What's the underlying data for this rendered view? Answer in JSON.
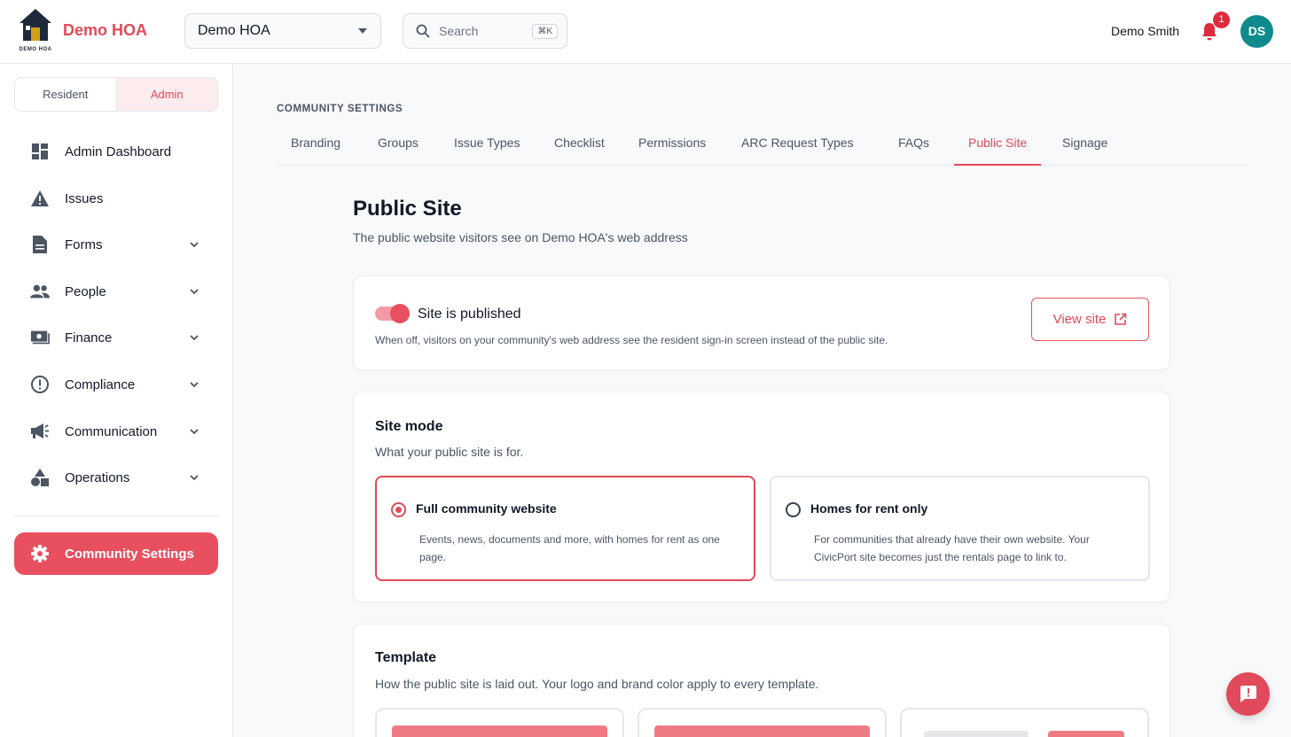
{
  "brand": {
    "name": "Demo HOA",
    "logo_caption": "DEMO HOA"
  },
  "header": {
    "hoa_select": "Demo HOA",
    "search_placeholder": "Search",
    "search_shortcut": "⌘K",
    "user_name": "Demo Smith",
    "notification_count": "1",
    "avatar_initials": "DS"
  },
  "sidebar": {
    "role_resident": "Resident",
    "role_admin": "Admin",
    "items": [
      {
        "label": "Admin Dashboard",
        "icon": "dashboard-icon"
      },
      {
        "label": "Issues",
        "icon": "warning-icon"
      },
      {
        "label": "Forms",
        "icon": "document-icon"
      },
      {
        "label": "People",
        "icon": "people-icon"
      },
      {
        "label": "Finance",
        "icon": "money-icon"
      },
      {
        "label": "Compliance",
        "icon": "alert-circle-icon"
      },
      {
        "label": "Communication",
        "icon": "megaphone-icon"
      },
      {
        "label": "Operations",
        "icon": "shapes-icon"
      }
    ],
    "settings_label": "Community Settings"
  },
  "main": {
    "section_label": "COMMUNITY SETTINGS",
    "tabs": [
      "Branding",
      "Groups",
      "Issue Types",
      "Checklist",
      "Permissions",
      "ARC Request Types",
      "FAQs",
      "Public Site",
      "Signage"
    ],
    "active_tab": "Public Site",
    "title": "Public Site",
    "subtitle": "The public website visitors see on Demo HOA's web address",
    "publish": {
      "label": "Site is published",
      "help": "When off, visitors on your community's web address see the resident sign-in screen instead of the public site.",
      "view_site": "View site",
      "enabled": true
    },
    "site_mode": {
      "heading": "Site mode",
      "description": "What your public site is for.",
      "options": [
        {
          "title": "Full community website",
          "description": "Events, news, documents and more, with homes for rent as one page.",
          "selected": true
        },
        {
          "title": "Homes for rent only",
          "description": "For communities that already have their own website. Your CivicPort site becomes just the rentals page to link to.",
          "selected": false
        }
      ]
    },
    "template": {
      "heading": "Template",
      "description": "How the public site is laid out. Your logo and brand color apply to every template."
    }
  },
  "colors": {
    "accent": "#e04a5a",
    "avatar": "#0f8a8d",
    "text": "#111827",
    "muted": "#4b5563"
  }
}
